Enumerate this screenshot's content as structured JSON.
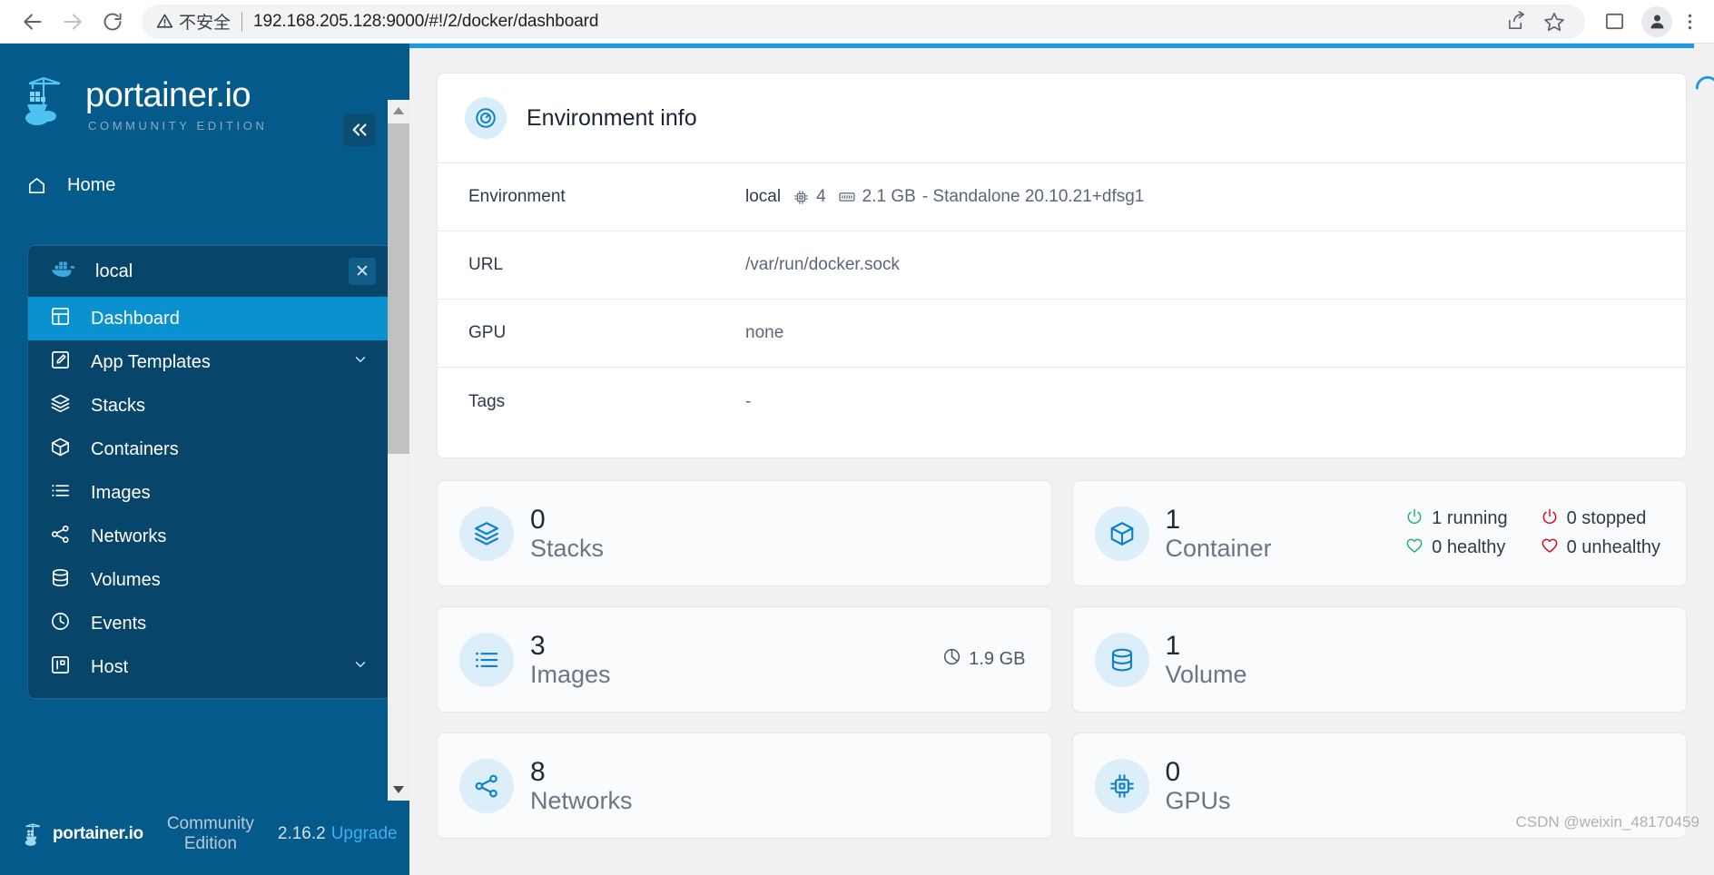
{
  "browser": {
    "back_icon": "arrow-left-icon",
    "forward_icon": "arrow-right-icon",
    "reload_icon": "reload-icon",
    "security_icon": "warning-triangle-icon",
    "security_label": "不安全",
    "url": "192.168.205.128:9000/#!/2/docker/dashboard",
    "share_icon": "share-icon",
    "bookmark_icon": "star-icon",
    "sidepanel_icon": "side-panel-icon",
    "profile_icon": "avatar-icon",
    "menu_icon": "three-dots-icon"
  },
  "sidebar": {
    "logo_title": "portainer.io",
    "logo_subtitle": "COMMUNITY EDITION",
    "collapse_icon": "chevron-double-left-icon",
    "home": {
      "label": "Home",
      "icon": "home-icon"
    },
    "environment": {
      "name": "local",
      "icon": "docker-whale-icon",
      "close_icon": "close-icon",
      "items": [
        {
          "label": "Dashboard",
          "icon": "dashboard-icon",
          "active": true,
          "chevron": false
        },
        {
          "label": "App Templates",
          "icon": "edit-square-icon",
          "active": false,
          "chevron": true
        },
        {
          "label": "Stacks",
          "icon": "layers-icon",
          "active": false,
          "chevron": false
        },
        {
          "label": "Containers",
          "icon": "cube-icon",
          "active": false,
          "chevron": false
        },
        {
          "label": "Images",
          "icon": "list-icon",
          "active": false,
          "chevron": false
        },
        {
          "label": "Networks",
          "icon": "share-nodes-icon",
          "active": false,
          "chevron": false
        },
        {
          "label": "Volumes",
          "icon": "database-icon",
          "active": false,
          "chevron": false
        },
        {
          "label": "Events",
          "icon": "clock-icon",
          "active": false,
          "chevron": false
        },
        {
          "label": "Host",
          "icon": "server-panel-icon",
          "active": false,
          "chevron": true
        }
      ]
    },
    "footer": {
      "brand": "portainer.io",
      "edition": "Community Edition",
      "version": "2.16.2",
      "upgrade": "Upgrade"
    },
    "scrollbar": {
      "up_icon": "triangle-up-icon",
      "down_icon": "triangle-down-icon"
    }
  },
  "main": {
    "env_card": {
      "icon": "gauge-icon",
      "title": "Environment info",
      "rows": [
        {
          "label": "Environment",
          "value_name": "local",
          "cpu_icon": "cpu-icon",
          "cpu": "4",
          "memory_icon": "memory-icon",
          "memory": "2.1 GB",
          "suffix": "- Standalone 20.10.21+dfsg1"
        },
        {
          "label": "URL",
          "value": "/var/run/docker.sock"
        },
        {
          "label": "GPU",
          "value": "none"
        },
        {
          "label": "Tags",
          "value": "-"
        }
      ]
    },
    "stats": [
      {
        "count": "0",
        "label": "Stacks",
        "icon": "layers-icon"
      },
      {
        "count": "1",
        "label": "Container",
        "icon": "cube-icon",
        "statuses": [
          {
            "icon": "power-icon",
            "text": "1 running",
            "color": "green"
          },
          {
            "icon": "power-icon",
            "text": "0 stopped",
            "color": "red"
          },
          {
            "icon": "heart-icon",
            "text": "0 healthy",
            "color": "green"
          },
          {
            "icon": "heart-icon",
            "text": "0 unhealthy",
            "color": "red"
          }
        ]
      },
      {
        "count": "3",
        "label": "Images",
        "icon": "list-icon",
        "size_icon": "pie-chart-icon",
        "size": "1.9 GB"
      },
      {
        "count": "1",
        "label": "Volume",
        "icon": "database-icon"
      },
      {
        "count": "8",
        "label": "Networks",
        "icon": "share-nodes-icon"
      },
      {
        "count": "0",
        "label": "GPUs",
        "icon": "chip-icon"
      }
    ],
    "watermark": "CSDN @weixin_48170459",
    "spinner_icon": "loading-spinner-icon"
  },
  "colors": {
    "sidebar_bg": "#055a8c",
    "sidebar_group_bg": "#07456a",
    "accent": "#0a92d0",
    "upgrade_link": "#3eb0ef",
    "status_green": "#17b169",
    "status_red": "#d0021b"
  }
}
